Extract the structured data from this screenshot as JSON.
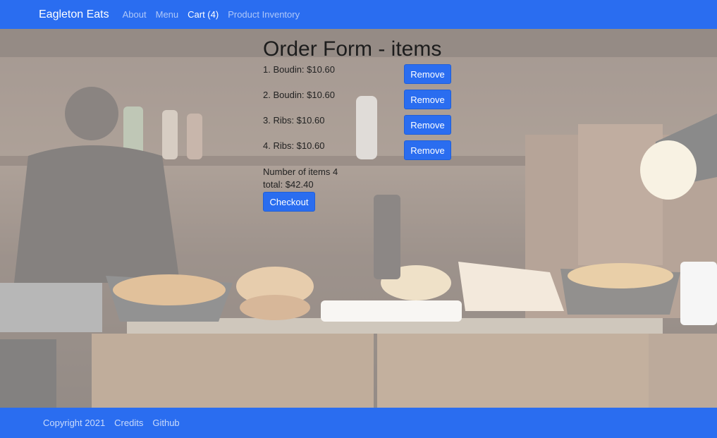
{
  "navbar": {
    "brand": "Eagleton Eats",
    "links": [
      {
        "label": "About"
      },
      {
        "label": "Menu"
      },
      {
        "label": "Cart (4)"
      },
      {
        "label": "Product Inventory"
      }
    ]
  },
  "order": {
    "title": "Order Form - items",
    "items": [
      {
        "label": "1. Boudin: $10.60",
        "button": "Remove"
      },
      {
        "label": "2. Boudin: $10.60",
        "button": "Remove"
      },
      {
        "label": "3. Ribs: $10.60",
        "button": "Remove"
      },
      {
        "label": "4. Ribs: $10.60",
        "button": "Remove"
      }
    ],
    "count_text": "Number of items 4",
    "total_text": "total: $42.40",
    "checkout_label": "Checkout"
  },
  "footer": {
    "links": [
      {
        "label": "Copyright 2021"
      },
      {
        "label": "Credits"
      },
      {
        "label": "Github"
      }
    ]
  },
  "colors": {
    "primary": "#2a6df0"
  }
}
